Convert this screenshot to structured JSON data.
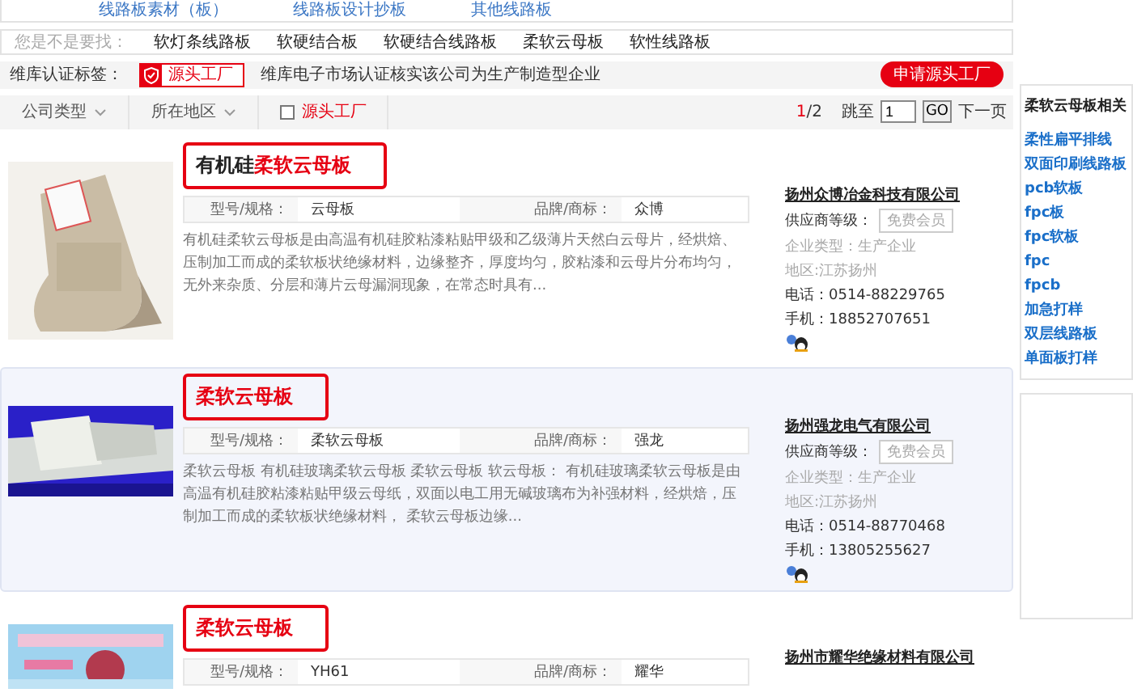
{
  "top_links": [
    "线路板素材（板）",
    "线路板设计抄板",
    "其他线路板"
  ],
  "suggest": {
    "label": "您是不是要找：",
    "items": [
      "软灯条线路板",
      "软硬结合板",
      "软硬结合线路板",
      "柔软云母板",
      "软性线路板"
    ]
  },
  "cert": {
    "label": "维库认证标签：",
    "badge": "源头工厂",
    "text": "维库电子市场认证核实该公司为生产制造型企业",
    "button": "申请源头工厂"
  },
  "filters": {
    "dropdowns": [
      "公司类型",
      "所在地区"
    ],
    "checkbox": {
      "label": "源头工厂",
      "checked": false
    },
    "page": "1",
    "total": "/2",
    "jump_label": "跳至",
    "jump_value": "1",
    "go": "GO",
    "next": "下一页"
  },
  "products": [
    {
      "kind": "picture",
      "title_prefix": "有机硅",
      "title": "柔软云母板",
      "spec_label": "型号/规格：",
      "spec": "云母板",
      "brand_label": "品牌/商标：",
      "brand": "众博",
      "description": "有机硅柔软云母板是由高温有机硅胶粘漆粘贴甲级和乙级薄片天然白云母片，经烘焙、压制加工而成的柔软板状绝缘材料，边缘整齐，厚度均匀，胶粘漆和云母片分布均匀，无外来杂质、分层和薄片云母漏洞现象，在常态时具有...",
      "highlighted": false,
      "company": "扬州众博冶金科技有限公司",
      "level_label": "供应商等级：",
      "level": "免费会员",
      "type": "企业类型：生产企业",
      "region": "地区:江苏扬州",
      "phone": "电话：0514-88229765",
      "mobile": "手机：18852707651"
    },
    {
      "kind": "picture",
      "title": "柔软云母板",
      "spec_label": "型号/规格：",
      "spec": "柔软云母板",
      "brand_label": "品牌/商标：",
      "brand": "强龙",
      "description": "柔软云母板 有机硅玻璃柔软云母板 柔软云母板 软云母板： 有机硅玻璃柔软云母板是由高温有机硅胶粘漆粘贴甲级云母纸，双面以电工用无碱玻璃布为补强材料，经烘焙，压制加工而成的柔软板状绝缘材料， 柔软云母板边缘...",
      "highlighted": true,
      "company": "扬州强龙电气有限公司",
      "level_label": "供应商等级：",
      "level": "免费会员",
      "type": "企业类型：生产企业",
      "region": "地区:江苏扬州",
      "phone": "电话：0514-88770468",
      "mobile": "手机：13805255627"
    },
    {
      "kind": "picture",
      "title": "柔软云母板",
      "spec_label": "型号/规格：",
      "spec": "YH61",
      "brand_label": "品牌/商标：",
      "brand": "耀华",
      "highlighted": false,
      "company": "扬州市耀华绝缘材料有限公司"
    }
  ],
  "sidebar": {
    "title": "柔软云母板相关",
    "links": [
      "柔性扁平排线",
      "双面印刷线路板",
      "pcb软板",
      "fpc板",
      "fpc软板",
      "fpc",
      "fpcb",
      "加急打样",
      "双层线路板",
      "单面板打样"
    ]
  }
}
